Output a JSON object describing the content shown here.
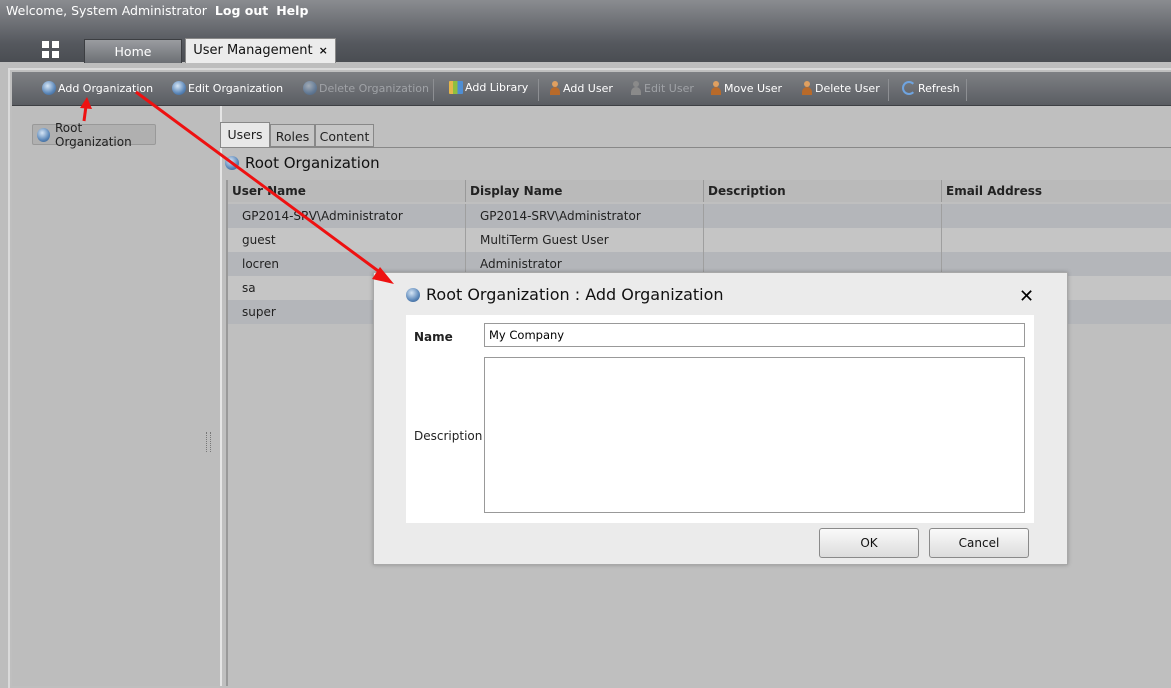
{
  "header": {
    "welcome": "Welcome, System Administrator",
    "logout": "Log out",
    "help": "Help"
  },
  "tabs": {
    "home": "Home",
    "user_management": "User Management",
    "close_glyph": "×"
  },
  "toolbar": {
    "add_org": "Add Organization",
    "edit_org": "Edit Organization",
    "delete_org": "Delete Organization",
    "add_library": "Add Library",
    "add_user": "Add User",
    "edit_user": "Edit User",
    "move_user": "Move User",
    "delete_user": "Delete User",
    "refresh": "Refresh"
  },
  "tree": {
    "root": "Root Organization"
  },
  "detail_tabs": {
    "users": "Users",
    "roles": "Roles",
    "content": "Content"
  },
  "detail": {
    "heading": "Root Organization"
  },
  "grid": {
    "headers": [
      "User Name",
      "Display Name",
      "Description",
      "Email Address"
    ],
    "rows": [
      [
        "GP2014-SRV\\Administrator",
        "GP2014-SRV\\Administrator",
        "",
        ""
      ],
      [
        "guest",
        "MultiTerm Guest User",
        "",
        ""
      ],
      [
        "locren",
        "Administrator",
        "",
        ""
      ],
      [
        "sa",
        "",
        "",
        ""
      ],
      [
        "super",
        "",
        "",
        ""
      ]
    ]
  },
  "dialog": {
    "title": "Root Organization : Add Organization",
    "close": "✕",
    "name_label": "Name",
    "name_value": "My Company",
    "description_label": "Description",
    "description_value": "",
    "ok": "OK",
    "cancel": "Cancel"
  },
  "colors": {
    "annotation_arrow": "#ee1111"
  }
}
